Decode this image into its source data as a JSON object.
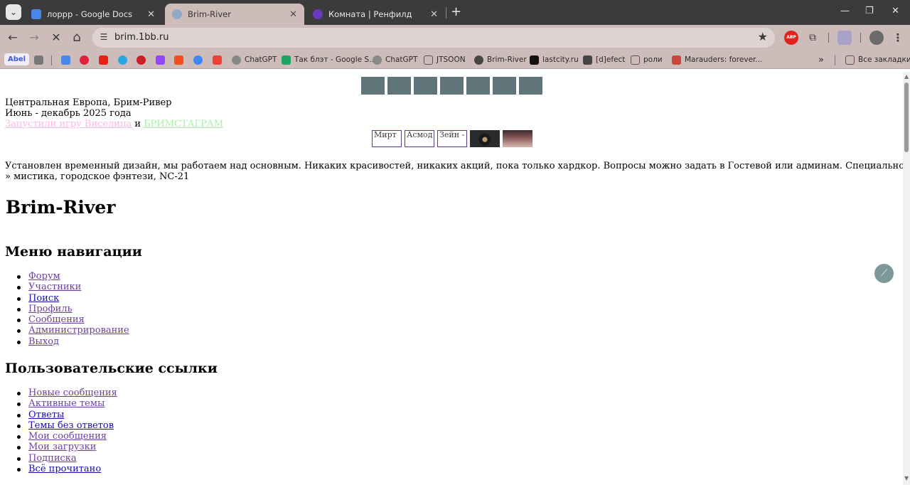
{
  "colors": {
    "chrome_dark": "#3b3b3b",
    "chrome_tint": "#cdbcb9",
    "nav_button": "#5f7579",
    "link_pink": "#ffb6e1",
    "link_green": "#a8f0a8",
    "link_visited": "#6b3fa0",
    "link_unvisited": "#1a0dab"
  },
  "tabs": [
    {
      "title": "лоррр - Google Docs",
      "icon": "google-docs-icon",
      "close": "✕"
    },
    {
      "title": "Brim-River",
      "icon": "site-favicon",
      "close": "✕"
    },
    {
      "title": "Комната | Ренфилд",
      "icon": "site-favicon",
      "close": "✕"
    }
  ],
  "tabbar": {
    "menu_glyph": "⌄",
    "newtab_glyph": "+",
    "minimize": "—",
    "maximize": "❐",
    "close": "✕"
  },
  "toolbar": {
    "back": "←",
    "forward": "→",
    "stop": "✕",
    "home": "⌂",
    "url": "brim.1bb.ru",
    "star": "★",
    "abp": "ABP",
    "puzzle": "⧉",
    "menu": "⋮"
  },
  "bookmarks": {
    "profile_chip": "Abel",
    "items": [
      {
        "label": "ChatGPT",
        "icon": "chatgpt-icon"
      },
      {
        "label": "Так блэт - Google S...",
        "icon": "google-sheets-icon"
      },
      {
        "label": "ChatGPT",
        "icon": "chatgpt-icon"
      },
      {
        "label": "JTSOON",
        "icon": "folder-icon"
      },
      {
        "label": "Brim-River",
        "icon": "wordpress-icon"
      },
      {
        "label": "lastcity.ru",
        "icon": "site-favicon"
      },
      {
        "label": "[d]efect",
        "icon": "site-favicon"
      },
      {
        "label": "роли",
        "icon": "folder-icon"
      },
      {
        "label": "Marauders: forever...",
        "icon": "site-favicon"
      }
    ],
    "overflow": "»",
    "all_bookmarks": "Все закладки"
  },
  "page": {
    "location": "Центральная Европа, Брим-Ривер",
    "dates": "Июнь - декабрь 2025 года",
    "link_game": "Запустили игру Виселица",
    "and": "и",
    "link_insta": "БРИМСТАГРАМ",
    "avatars": [
      "Мирт",
      "Асмод",
      "Зейн -"
    ],
    "notice": "Установлен временный дизайн, мы работаем над основным. Никаких красивостей, никаких акций, пока только хардкор. Вопросы можно задать в Гостевой или админам. Специально подобрали состав на любой вкус.",
    "genre": "» мистика, городское фэнтези, NC-21",
    "site_title": "Brim-River",
    "nav_heading": "Меню навигации",
    "nav_items": [
      "Форум",
      "Участники",
      "Поиск",
      "Профиль",
      "Сообщения",
      "Администрирование",
      "Выход"
    ],
    "user_heading": "Пользовательские ссылки",
    "user_items": [
      "Новые сообщения",
      "Активные темы",
      "Ответы",
      "Темы без ответов",
      "Мои сообщения",
      "Мои загрузки",
      "Подписка",
      "Всё прочитано"
    ]
  }
}
